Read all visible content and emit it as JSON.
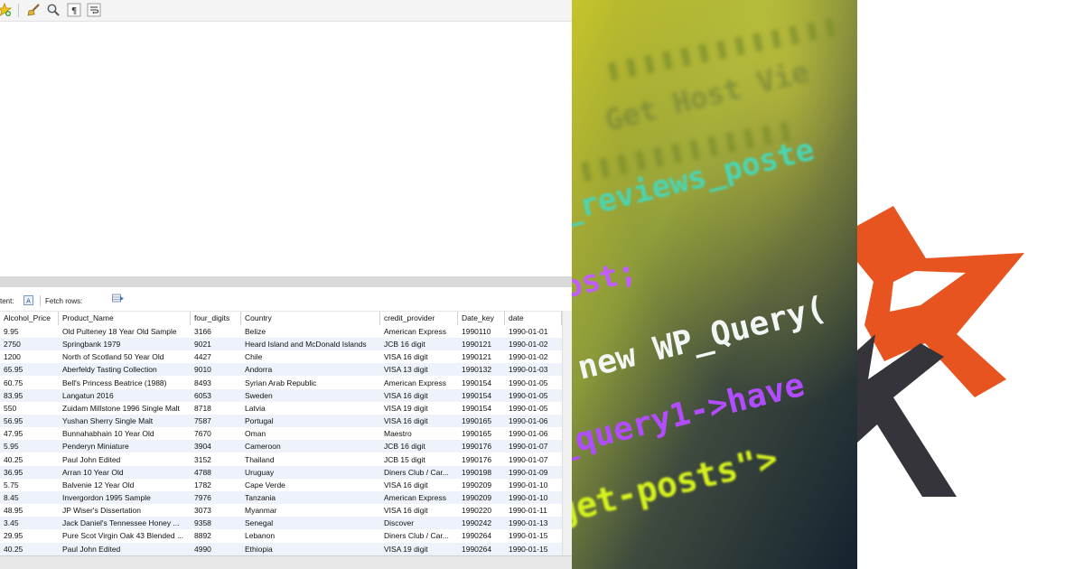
{
  "toolbar": {
    "icons": [
      "star-add-icon",
      "broom-icon",
      "magnifier-icon",
      "pilcrow-icon",
      "wrap-icon"
    ]
  },
  "results_toolbar": {
    "content_label": "tent:",
    "fetch_rows_label": "Fetch rows:"
  },
  "grid": {
    "columns": [
      "Alcohol_Price",
      "Product_Name",
      "four_digits",
      "Country",
      "credit_provider",
      "Date_key",
      "date"
    ],
    "rows": [
      [
        "9.95",
        "Old Pulteney 18 Year Old Sample",
        "3166",
        "Belize",
        "American Express",
        "1990110",
        "1990-01-01"
      ],
      [
        "2750",
        "Springbank 1979",
        "9021",
        "Heard Island and McDonald Islands",
        "JCB 16 digit",
        "1990121",
        "1990-01-02"
      ],
      [
        "1200",
        "North of Scotland 50 Year Old",
        "4427",
        "Chile",
        "VISA 16 digit",
        "1990121",
        "1990-01-02"
      ],
      [
        "65.95",
        "Aberfeldy Tasting Collection",
        "9010",
        "Andorra",
        "VISA 13 digit",
        "1990132",
        "1990-01-03"
      ],
      [
        "60.75",
        "Bell's Princess Beatrice (1988)",
        "8493",
        "Syrian Arab Republic",
        "American Express",
        "1990154",
        "1990-01-05"
      ],
      [
        "83.95",
        "Langatun 2016",
        "6053",
        "Sweden",
        "VISA 16 digit",
        "1990154",
        "1990-01-05"
      ],
      [
        "550",
        "Zuidam Millstone 1996 Single Malt",
        "8718",
        "Latvia",
        "VISA 19 digit",
        "1990154",
        "1990-01-05"
      ],
      [
        "56.95",
        "Yushan Sherry Single Malt",
        "7587",
        "Portugal",
        "VISA 16 digit",
        "1990165",
        "1990-01-06"
      ],
      [
        "47.95",
        "Bunnahabhain 10 Year Old",
        "7670",
        "Oman",
        "Maestro",
        "1990165",
        "1990-01-06"
      ],
      [
        "5.95",
        "Penderyn Miniature",
        "3904",
        "Cameroon",
        "JCB 16 digit",
        "1990176",
        "1990-01-07"
      ],
      [
        "40.25",
        "Paul John Edited",
        "3152",
        "Thailand",
        "JCB 15 digit",
        "1990176",
        "1990-01-07"
      ],
      [
        "36.95",
        "Arran 10 Year Old",
        "4788",
        "Uruguay",
        "Diners Club / Car...",
        "1990198",
        "1990-01-09"
      ],
      [
        "5.75",
        "Balvenie 12 Year Old",
        "1782",
        "Cape Verde",
        "VISA 16 digit",
        "1990209",
        "1990-01-10"
      ],
      [
        "8.45",
        "Invergordon 1995 Sample",
        "7976",
        "Tanzania",
        "American Express",
        "1990209",
        "1990-01-10"
      ],
      [
        "48.95",
        "JP Wiser's Dissertation",
        "3073",
        "Myanmar",
        "VISA 16 digit",
        "1990220",
        "1990-01-11"
      ],
      [
        "3.45",
        "Jack Daniel's Tennessee Honey ...",
        "9358",
        "Senegal",
        "Discover",
        "1990242",
        "1990-01-13"
      ],
      [
        "29.95",
        "Pure Scot Virgin Oak 43 Blended ...",
        "8892",
        "Lebanon",
        "Diners Club / Car...",
        "1990264",
        "1990-01-15"
      ],
      [
        "40.25",
        "Paul John Edited",
        "4990",
        "Ethiopia",
        "VISA 19 digit",
        "1990264",
        "1990-01-15"
      ]
    ]
  },
  "code_image": {
    "lines": [
      "Get Host Vie",
      "_reviews_poste",
      "ost;",
      "new WP_Query(",
      "_query1->have",
      "get-posts\">"
    ],
    "colors": {
      "teal": "#49d6b4",
      "white": "#f2f6f4",
      "purple": "#b14cff",
      "orange": "#ff9a2b",
      "lime": "#d6f21c"
    }
  },
  "logo": {
    "icon": "star-k-logo-icon",
    "colors": {
      "orange": "#e8541f",
      "dark": "#35343a"
    }
  }
}
